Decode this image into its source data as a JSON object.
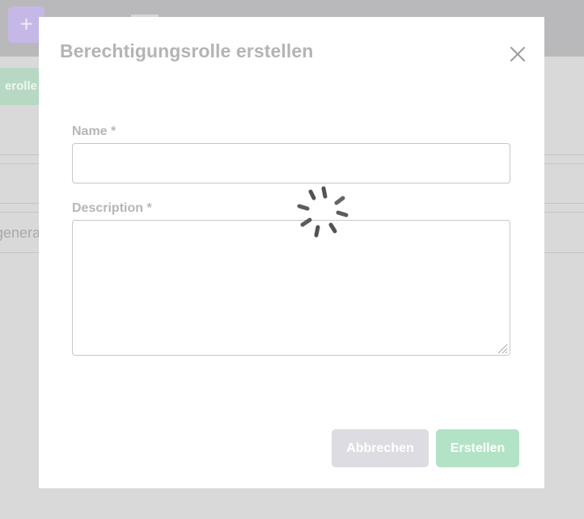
{
  "background": {
    "add_button_glyph": "+",
    "chip_text": "erolle",
    "row_text": "genera"
  },
  "dialog": {
    "title": "Berechtigungsrolle erstellen",
    "close_icon": "close-icon",
    "fields": {
      "name": {
        "label": "Name *",
        "value": "",
        "placeholder": ""
      },
      "description": {
        "label": "Description *",
        "value": "",
        "placeholder": ""
      }
    },
    "loading": true,
    "buttons": {
      "cancel_label": "Abbrechen",
      "create_label": "Erstellen"
    }
  },
  "colors": {
    "overlay": "#d9d9d9",
    "cancel_button": "#dcdce2",
    "create_button": "#b3e3c6",
    "accent_purple": "#c6b8e6"
  }
}
